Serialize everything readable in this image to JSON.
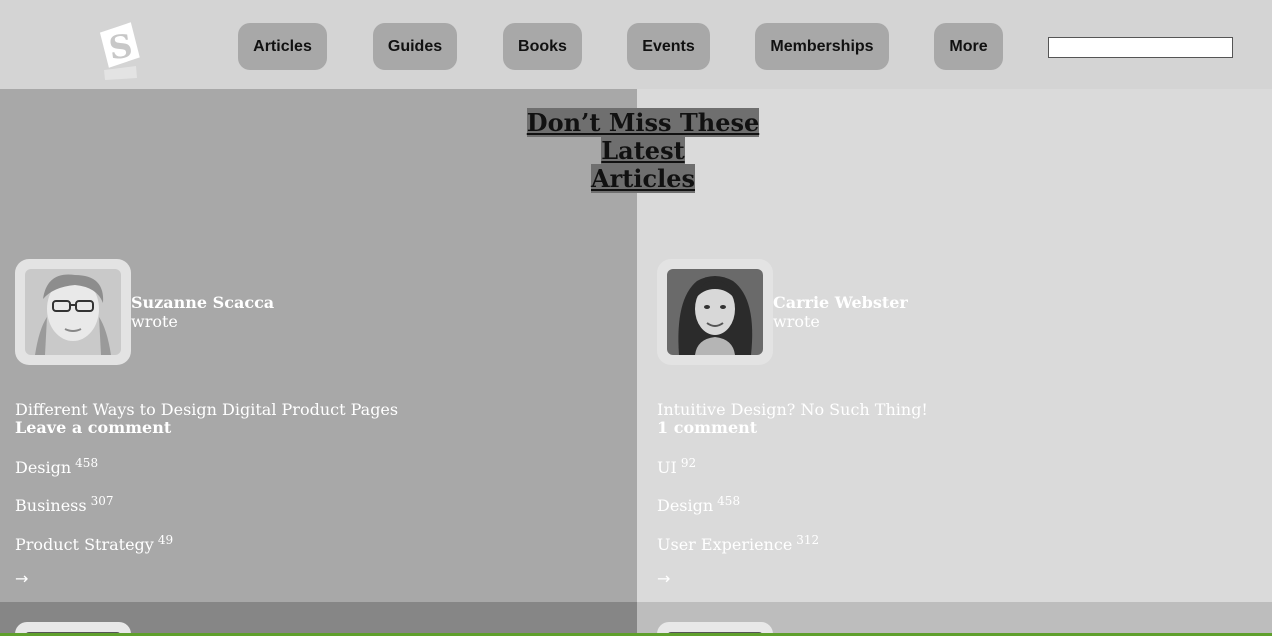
{
  "nav": {
    "items": [
      {
        "label": "Articles"
      },
      {
        "label": "Guides"
      },
      {
        "label": "Books"
      },
      {
        "label": "Events"
      },
      {
        "label": "Memberships"
      },
      {
        "label": "More"
      }
    ],
    "search_placeholder": ""
  },
  "heading": {
    "line1": "Don’t Miss These Latest",
    "line2": "Articles"
  },
  "articles": [
    {
      "author": "Suzanne Scacca",
      "wrote": "wrote",
      "title": "Different Ways to Design Digital Product Pages",
      "comments": "Leave a comment",
      "tags": [
        {
          "name": "Design",
          "count": "458"
        },
        {
          "name": "Business",
          "count": "307"
        },
        {
          "name": "Product Strategy",
          "count": "49"
        }
      ],
      "arrow": "→"
    },
    {
      "author": "Carrie Webster",
      "wrote": "wrote",
      "title": "Intuitive Design? No Such Thing!",
      "comments": "1 comment",
      "tags": [
        {
          "name": "UI",
          "count": "92"
        },
        {
          "name": "Design",
          "count": "458"
        },
        {
          "name": "User Experience",
          "count": "312"
        }
      ],
      "arrow": "→"
    }
  ]
}
